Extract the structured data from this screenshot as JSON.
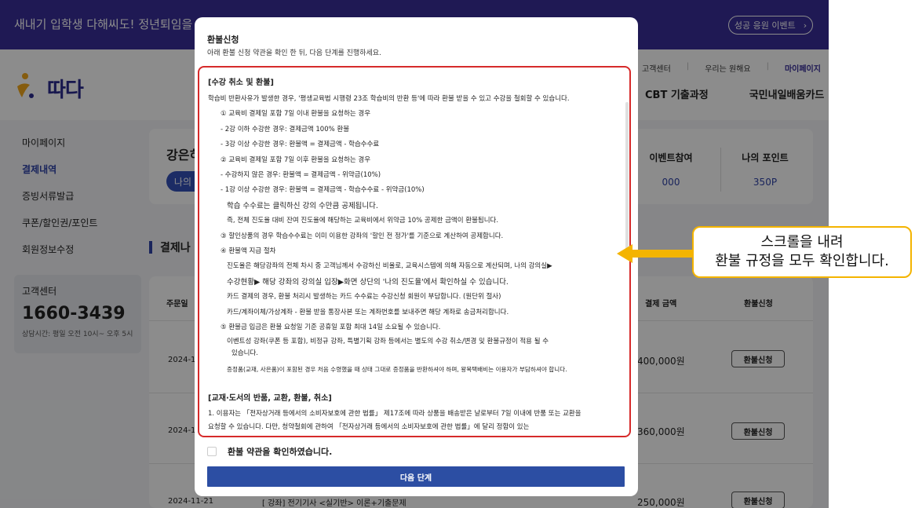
{
  "banner": {
    "text": "새내기 입학생 다해씨도! 정년퇴임을 앞둔",
    "event_button": "성공 응원 이벤트"
  },
  "header": {
    "logo_text": "따다",
    "util_links": [
      "고객센터",
      "우리는 원해요",
      "마이페이지"
    ],
    "gnb": [
      "CBT 기출과정",
      "국민내일배움카드"
    ]
  },
  "sidebar": {
    "items": [
      {
        "label": "마이페이지",
        "active": false
      },
      {
        "label": "결제내역",
        "active": true
      },
      {
        "label": "증빙서류발급",
        "active": false
      },
      {
        "label": "쿠폰/할인권/포인트",
        "active": false
      },
      {
        "label": "회원정보수정",
        "active": false
      }
    ],
    "cs": {
      "title": "고객센터",
      "phone": "1660-3439",
      "hours": "상담시간: 평일 오전 10시~ 오후 5시"
    }
  },
  "summary": {
    "greeting": "강은히",
    "pill_label": "나의",
    "stats": [
      {
        "label": "이벤트참여",
        "value": "000"
      },
      {
        "label": "나의 포인트",
        "value": "350P"
      }
    ]
  },
  "section": {
    "title": "결제나"
  },
  "table": {
    "headers": [
      "주문일",
      "결제 금액",
      "환불신청"
    ],
    "rows": [
      {
        "date": "2024-1",
        "amount": "400,000원",
        "course": "",
        "refund": "환불신청"
      },
      {
        "date": "2024-1",
        "amount": "360,000원",
        "course": "",
        "refund": "환불신청"
      },
      {
        "date": "2024-11-21",
        "amount": "250,000원",
        "course": "[ 강좌] 전기기사 <실기반> 이론+기출문제",
        "refund": "환불신청"
      }
    ]
  },
  "modal": {
    "title": "환불신청",
    "subtitle": "아래 환불 신청 약관을 확인 한 뒤, 다음 단계를 진행하세요.",
    "terms": {
      "section1_title": "[수강 취소 및 환불]",
      "lines": [
        "학습비 반환사유가 발생한 경우, '평생교육법 시행령 23조 학습비의 반환 등'에 따라 환불 받을 수 있고 수강을 철회할 수 있습니다.",
        "① 교육비 결제일 포함 7일 이내 환불을 요청하는 경우",
        "- 2강 이하 수강한 경우: 결제금액 100% 환불",
        "- 3강 이상 수강한 경우: 환불액 = 결제금액 - 학습수수료",
        "② 교육비 결제일 포함 7일 이후 환불을 요청하는 경우",
        "- 수강하지 않은 경우: 환불액 = 결제금액 - 위약금(10%)",
        "- 1강 이상 수강한 경우: 환불액 = 결제금액 - 학습수수료 - 위약금(10%)",
        "학습 수수료는 클릭하신 강의 수만큼 공제됩니다.",
        "즉, 전체 진도율 대비 잔여 진도율에 해당하는 교육비에서 위약금 10% 공제한 금액이 환불됩니다.",
        "③ 할인상품의 경우 학습수수료는 이미 이용한 강좌의 '할인 전 정가'를 기준으로 계산하여 공제합니다.",
        "④ 환불액 지급 절차",
        "진도율은 해당강좌의 전체 차시 중 고객님께서 수강하신 비율로, 교육시스템에 의해 자동으로 계산되며, 나의 강의실▶",
        "수강현황▶ 해당 강좌의 강의실 입장▶화면 상단의 '나의 진도율'에서 확인하실 수 있습니다.",
        "카드 결제의 경우, 환불 처리시 발생하는 카드 수수료는 수강신청 회원이 부담합니다. (원단위 절사)",
        "카드/계좌이체/가상계좌 - 환불 받을 통장사본 또는 계좌번호를 보내주면 해당 계좌로 송금처리합니다.",
        "⑤ 환불금 입금은 환불 요청일 기준 공휴일 포함 최대 14일 소요될 수 있습니다.",
        "이벤트성 강좌(쿠폰 등 포함), 비정규 강좌, 특별기획 강좌 등에서는 별도의 수강 취소/변경 및 환불규정이 적용 될 수",
        "있습니다.",
        "증정품(교재, 사은품)이 포함된 경우 처음 수령했을 때 상태 그대로 증정품을 반환하셔야 하며, 왕복택배비는 이용자가 부담하셔야 합니다."
      ],
      "section2_title": "[교재·도서의 반품, 교환, 환불, 취소]",
      "lines2": [
        "1. 이용자는 「전자상거래 등에서의 소비자보호에 관한 법률」 제17조에 따라 상품을 배송받은 날로부터 7일 이내에 반품 또는 교환을",
        "요청할 수 있습니다. 다만, 청약철회에 관하여 「전자상거래 등에서의 소비자보호에 관한 법률」에 달리 정함이 있는"
      ]
    },
    "agree_label": "환불 약관을 확인하였습니다.",
    "next_button": "다음 단계"
  },
  "annotation": {
    "line1": "스크롤을 내려",
    "line2": "환불 규정을 모두 확인합니다.",
    "border_color": "#f4b400"
  },
  "colors": {
    "banner": "#3a2f9a",
    "primary": "#2c4ea3",
    "highlight_border": "#d62a2a",
    "callout_border": "#f4b400"
  }
}
